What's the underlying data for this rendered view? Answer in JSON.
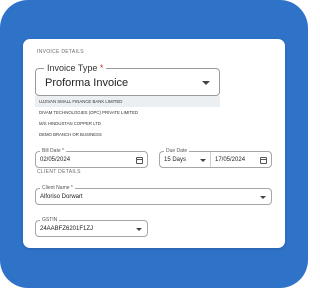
{
  "invoice_details": {
    "section_title": "INVOICE DETAILS",
    "invoice_type": {
      "label": "Invoice Type",
      "required_mark": "*",
      "value": "Proforma Invoice",
      "options": [
        {
          "label": "UJJIVAN SMALL FINANCE BANK LIMITED",
          "selected": true
        },
        {
          "label": "DIVAM TECHNOLOGIES (OPC) PRIVATE LIMITED",
          "selected": false
        },
        {
          "label": "M/S HINDUSTAN COPPER LTD",
          "selected": false
        },
        {
          "label": "DEMO BRANCH OR BUSINESS",
          "selected": false
        }
      ]
    },
    "bill_date": {
      "label": "Bill Date *",
      "value": "02/05/2024"
    },
    "due_date": {
      "label": "Due Date",
      "term": "15 Days",
      "value": "17/05/2024"
    }
  },
  "client_details": {
    "section_title": "CLIENT DETAILS",
    "client_name": {
      "label": "Client Name *",
      "value": "Alforiso Dorwart"
    },
    "gstin": {
      "label": "GSTIN",
      "value": "24AABFZ6201F1ZJ"
    }
  },
  "colors": {
    "frame": "#2f73c9",
    "required": "#d32f2f",
    "selected_option": "#eceff2"
  }
}
